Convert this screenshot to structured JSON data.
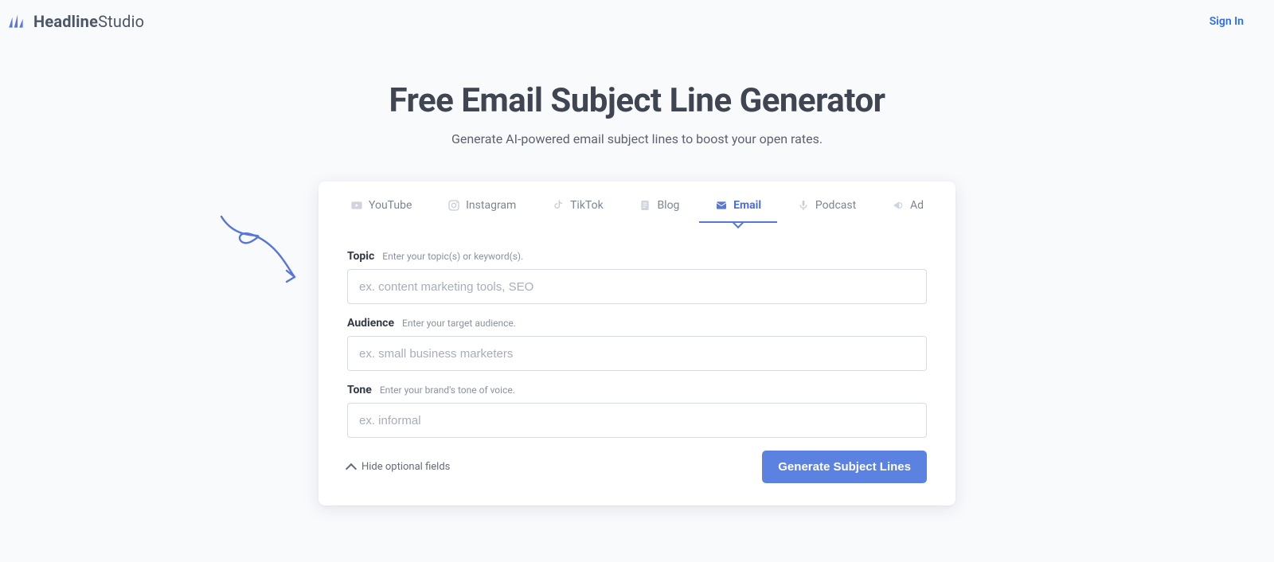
{
  "brand": {
    "bold": "Headline",
    "light": "Studio"
  },
  "header": {
    "signin": "Sign In"
  },
  "hero": {
    "title": "Free Email Subject Line Generator",
    "subtitle": "Generate AI-powered email subject lines to boost your open rates."
  },
  "tabs": [
    {
      "id": "youtube",
      "label": "YouTube",
      "icon": "youtube-icon"
    },
    {
      "id": "instagram",
      "label": "Instagram",
      "icon": "instagram-icon"
    },
    {
      "id": "tiktok",
      "label": "TikTok",
      "icon": "tiktok-icon"
    },
    {
      "id": "blog",
      "label": "Blog",
      "icon": "blog-icon"
    },
    {
      "id": "email",
      "label": "Email",
      "icon": "email-icon",
      "active": true
    },
    {
      "id": "podcast",
      "label": "Podcast",
      "icon": "podcast-icon"
    },
    {
      "id": "ad",
      "label": "Ad",
      "icon": "ad-icon"
    }
  ],
  "form": {
    "topic": {
      "label": "Topic",
      "help": "Enter your topic(s) or keyword(s).",
      "placeholder": "ex. content marketing tools, SEO"
    },
    "audience": {
      "label": "Audience",
      "help": "Enter your target audience.",
      "placeholder": "ex. small business marketers"
    },
    "tone": {
      "label": "Tone",
      "help": "Enter your brand's tone of voice.",
      "placeholder": "ex. informal"
    }
  },
  "controls": {
    "toggleOptional": "Hide optional fields",
    "submit": "Generate Subject Lines"
  },
  "colors": {
    "accent": "#5878d6",
    "button": "#5b82e0"
  }
}
